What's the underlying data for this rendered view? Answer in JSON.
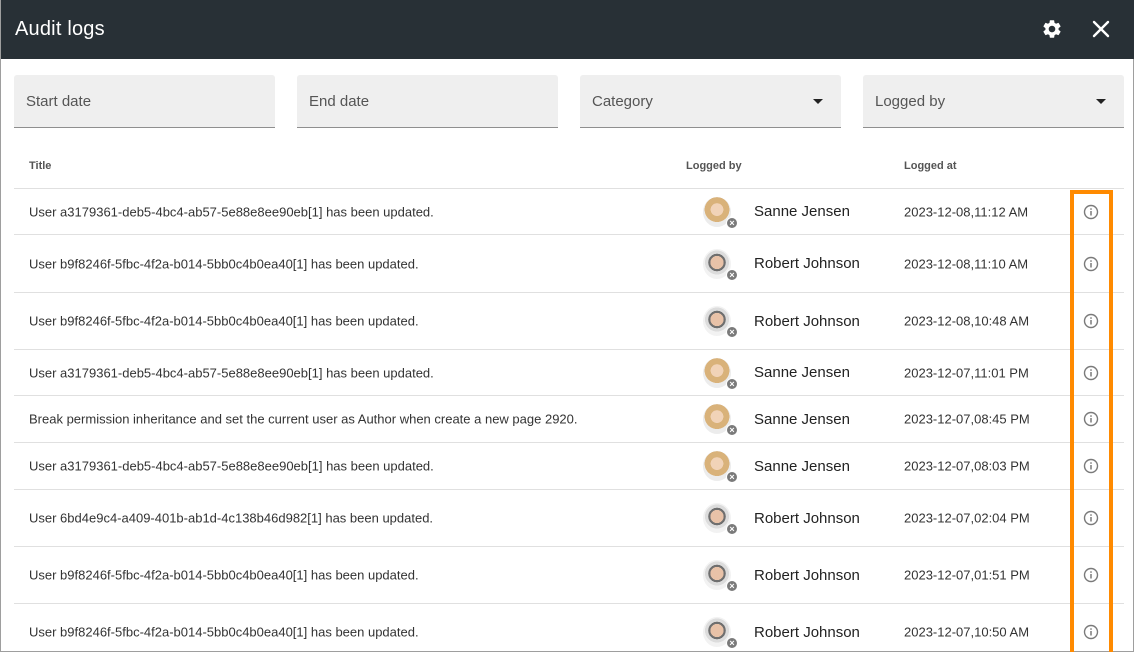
{
  "window": {
    "title": "Audit logs"
  },
  "filters": {
    "start_date": "Start date",
    "end_date": "End date",
    "category": "Category",
    "logged_by": "Logged by"
  },
  "table": {
    "columns": {
      "title": "Title",
      "logged_by": "Logged by",
      "logged_at": "Logged at"
    },
    "rows": [
      {
        "title": "User a3179361-deb5-4bc4-ab57-5e88e8ee90eb[1] has been updated.",
        "user": "Sanne Jensen",
        "time": "2023-12-08,11:12 AM"
      },
      {
        "title": "User b9f8246f-5fbc-4f2a-b014-5bb0c4b0ea40[1] has been updated.",
        "user": "Robert Johnson",
        "time": "2023-12-08,11:10 AM"
      },
      {
        "title": "User b9f8246f-5fbc-4f2a-b014-5bb0c4b0ea40[1] has been updated.",
        "user": "Robert Johnson",
        "time": "2023-12-08,10:48 AM"
      },
      {
        "title": "User a3179361-deb5-4bc4-ab57-5e88e8ee90eb[1] has been updated.",
        "user": "Sanne Jensen",
        "time": "2023-12-07,11:01 PM"
      },
      {
        "title": "Break permission inheritance and set the current user as Author when create a new page 2920.",
        "user": "Sanne Jensen",
        "time": "2023-12-07,08:45 PM"
      },
      {
        "title": "User a3179361-deb5-4bc4-ab57-5e88e8ee90eb[1] has been updated.",
        "user": "Sanne Jensen",
        "time": "2023-12-07,08:03 PM"
      },
      {
        "title": "User 6bd4e9c4-a409-401b-ab1d-4c138b46d982[1] has been updated.",
        "user": "Robert Johnson",
        "time": "2023-12-07,02:04 PM"
      },
      {
        "title": "User b9f8246f-5fbc-4f2a-b014-5bb0c4b0ea40[1] has been updated.",
        "user": "Robert Johnson",
        "time": "2023-12-07,01:51 PM"
      },
      {
        "title": "User b9f8246f-5fbc-4f2a-b014-5bb0c4b0ea40[1] has been updated.",
        "user": "Robert Johnson",
        "time": "2023-12-07,10:50 AM"
      }
    ]
  },
  "colors": {
    "header_bg": "#283036",
    "highlight": "#ff8a00"
  },
  "icons": {
    "settings": "gear-icon",
    "close": "close-icon",
    "info": "info-icon",
    "remove": "remove-user-icon"
  }
}
